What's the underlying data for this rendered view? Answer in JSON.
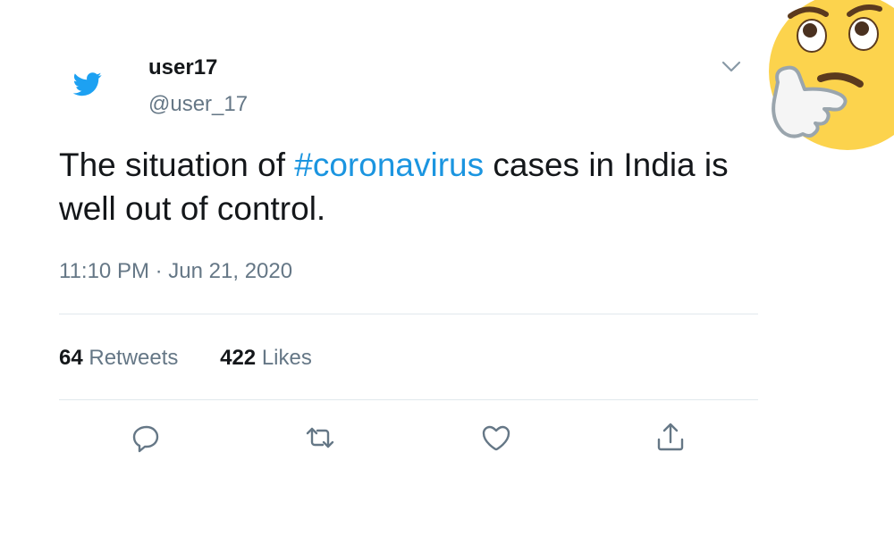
{
  "tweet": {
    "display_name": "user17",
    "handle": "@user_17",
    "text_before": "The situation of ",
    "hashtag": "#coronavirus",
    "text_after": " cases in India is well out of control.",
    "time": "11:10 PM",
    "separator": "·",
    "date": "Jun 21, 2020"
  },
  "stats": {
    "retweets_count": "64",
    "retweets_label": "Retweets",
    "likes_count": "422",
    "likes_label": "Likes"
  },
  "icons": {
    "logo": "twitter-bird-icon",
    "caret": "chevron-down-icon",
    "reply": "reply-icon",
    "retweet": "retweet-icon",
    "like": "heart-icon",
    "share": "share-icon",
    "emoji": "thinking-face-emoji"
  },
  "colors": {
    "brand": "#1da1f2",
    "hashtag": "#1b95e0",
    "secondary_text": "#657786",
    "primary_text": "#14171a",
    "divider": "#e1e8ed",
    "emoji_face": "#fcd34d"
  }
}
